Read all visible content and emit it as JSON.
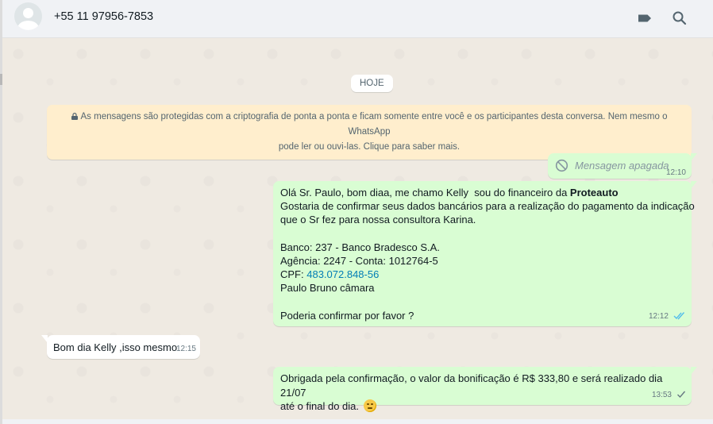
{
  "header": {
    "contact_name": "+55 11 97956-7853",
    "icons": [
      "label-icon",
      "search-icon"
    ],
    "icon_color": "#54656f"
  },
  "chat": {
    "date_chip": "HOJE",
    "e2e_notice_line1": "As mensagens são protegidas com a criptografia de ponta a ponta e ficam somente entre você e os participantes desta conversa. Nem mesmo o WhatsApp",
    "e2e_notice_line2": "pode ler ou ouvi-las. Clique para saber mais.",
    "messages": [
      {
        "direction": "out",
        "deleted": true,
        "text": "Mensagem apagada",
        "time": "12:10"
      },
      {
        "direction": "out",
        "line1_prefix": "Olá Sr. Paulo, bom diaa, me chamo Kelly  sou do financeiro da ",
        "line1_bold": "Proteauto",
        "line2": "Gostaria de confirmar seus dados bancários para a realização do pagamento da indicação",
        "line3": "que o Sr fez para nossa consultora Karina.",
        "line4": "Banco: 237 - Banco Bradesco S.A.",
        "line5": "Agência: 2247 - Conta: 1012764-5",
        "cpf_label": "CPF: ",
        "cpf_value": "483.072.848-56",
        "line7": "Paulo Bruno câmara",
        "line8": "Poderia confirmar por favor ?",
        "time": "12:12",
        "status": "read"
      },
      {
        "direction": "in",
        "text": "Bom dia Kelly ,isso mesmo",
        "time": "12:15"
      },
      {
        "direction": "out",
        "line1": "Obrigada pela confirmação, o valor da bonificação é R$ 333,80 e será realizado dia 21/07",
        "line2": "até o final do dia.",
        "emoji": "winking-face-emoji",
        "time": "13:53",
        "status": "sent"
      }
    ]
  },
  "colors": {
    "outgoing_bubble": "#d9fdd3",
    "incoming_bubble": "#ffffff",
    "chat_background": "#efeae2",
    "notice_background": "#ffeecd",
    "link": "#027eb5",
    "read_ticks": "#53bdeb"
  }
}
